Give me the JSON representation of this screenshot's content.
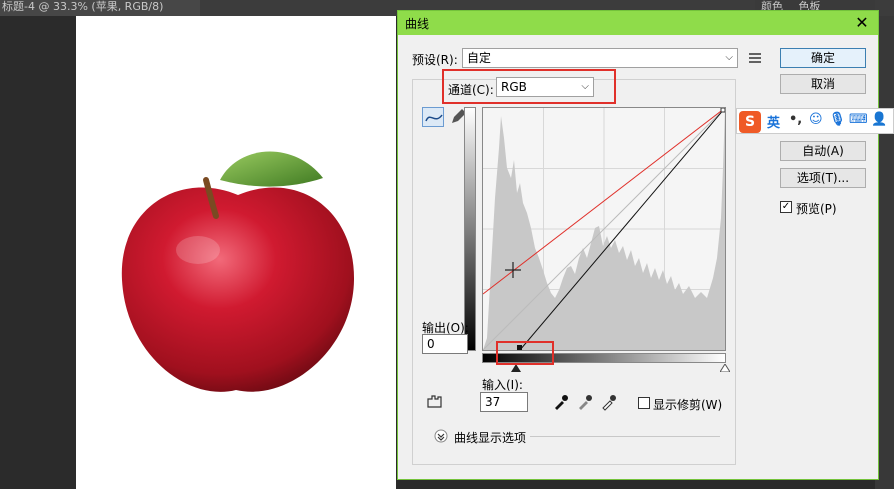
{
  "photoshop": {
    "doc_tab": "标题-4 @ 33.3% (苹果, RGB/8)",
    "panel_tabs": [
      "颜色",
      "色板"
    ]
  },
  "dialog": {
    "title": "曲线",
    "preset_label": "预设(R):",
    "preset_value": "自定",
    "channel_label": "通道(C):",
    "channel_value": "RGB",
    "output_label": "输出(O):",
    "output_value": "0",
    "input_label": "输入(I):",
    "input_value": "37",
    "show_clipping_label": "显示修剪(W)",
    "curve_options_label": "曲线显示选项",
    "buttons": {
      "ok": "确定",
      "cancel": "取消",
      "auto": "自动(A)",
      "options": "选项(T)..."
    },
    "preview_label": "预览(P)",
    "preview_checked": true
  },
  "ime_toolbar": {
    "logo": "S",
    "lang": "英"
  },
  "colors": {
    "title_bar": "#8fdc4a",
    "highlight_box": "#e0302a",
    "curve_reference": "#e0302a"
  }
}
